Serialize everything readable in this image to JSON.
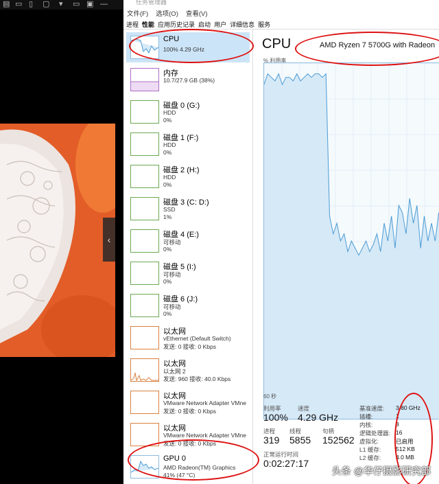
{
  "window_title": "任务管理器",
  "menu": [
    "文件(F)",
    "选项(O)",
    "查看(V)"
  ],
  "tabs": [
    "进程",
    "性能",
    "应用历史记录",
    "启动",
    "用户",
    "详细信息",
    "服务"
  ],
  "active_tab": "性能",
  "sidebar": [
    {
      "name": "CPU",
      "sub1": "100% 4.29 GHz",
      "sub2": "",
      "kind": "cpu"
    },
    {
      "name": "内存",
      "sub1": "10.7/27.9 GB (38%)",
      "sub2": "",
      "kind": "mem"
    },
    {
      "name": "磁盘 0 (G:)",
      "sub1": "HDD",
      "sub2": "0%",
      "kind": "disk"
    },
    {
      "name": "磁盘 1 (F:)",
      "sub1": "HDD",
      "sub2": "0%",
      "kind": "disk"
    },
    {
      "name": "磁盘 2 (H:)",
      "sub1": "HDD",
      "sub2": "0%",
      "kind": "disk"
    },
    {
      "name": "磁盘 3 (C: D:)",
      "sub1": "SSD",
      "sub2": "1%",
      "kind": "disk"
    },
    {
      "name": "磁盘 4 (E:)",
      "sub1": "可移动",
      "sub2": "0%",
      "kind": "disk"
    },
    {
      "name": "磁盘 5 (I:)",
      "sub1": "可移动",
      "sub2": "0%",
      "kind": "disk"
    },
    {
      "name": "磁盘 6 (J:)",
      "sub1": "可移动",
      "sub2": "0%",
      "kind": "disk"
    },
    {
      "name": "以太网",
      "sub1": "vEthernet (Default Switch)",
      "sub2": "发送: 0 接收: 0 Kbps",
      "kind": "net"
    },
    {
      "name": "以太网",
      "sub1": "以太网 2",
      "sub2": "发送: 960 接收: 40.0 Kbps",
      "kind": "net"
    },
    {
      "name": "以太网",
      "sub1": "VMware Network Adapter VMne",
      "sub2": "发送: 0 接收: 0 Kbps",
      "kind": "net"
    },
    {
      "name": "以太网",
      "sub1": "VMware Network Adapter VMne",
      "sub2": "发送: 0 接收: 0 Kbps",
      "kind": "net"
    },
    {
      "name": "GPU 0",
      "sub1": "AMD Radeon(TM) Graphics",
      "sub2": "41% (47 °C)",
      "kind": "gpu"
    }
  ],
  "main": {
    "title": "CPU",
    "model": "AMD Ryzen 7 5700G with Radeon",
    "util_label": "% 利用率",
    "time_label": "60 秒",
    "utilization_label": "利用率",
    "utilization": "100%",
    "speed_label": "速度",
    "speed": "4.29 GHz",
    "processes_label": "进程",
    "processes": "319",
    "threads_label": "线程",
    "threads": "5855",
    "handles_label": "句柄",
    "handles": "152562",
    "uptime_label": "正常运行时间",
    "uptime": "0:02:27:17",
    "details": [
      {
        "k": "基准速度:",
        "v": "3.80 GHz"
      },
      {
        "k": "插槽:",
        "v": "1"
      },
      {
        "k": "内核:",
        "v": "8"
      },
      {
        "k": "逻辑处理器:",
        "v": "16"
      },
      {
        "k": "虚拟化:",
        "v": "已启用"
      },
      {
        "k": "L1 缓存:",
        "v": "512 KB"
      },
      {
        "k": "L2 缓存:",
        "v": "4.0 MB"
      }
    ]
  },
  "cpu_history_percent": [
    94,
    97,
    96,
    95,
    97,
    94,
    96,
    96,
    95,
    97,
    95,
    96,
    97,
    96,
    97,
    97,
    96,
    97,
    57,
    52,
    55,
    50,
    52,
    47,
    50,
    48,
    46,
    48,
    50,
    47,
    49,
    52,
    47,
    55,
    50,
    57,
    48,
    60,
    58,
    52,
    62,
    55,
    60,
    48,
    57,
    50,
    55,
    50,
    58,
    53
  ],
  "watermark": "头条 @华仔摄影研究部",
  "colors": {
    "cpu_line": "#4a9bd4",
    "cpu_fill": "#d6e9f7",
    "annotation": "#dd1111",
    "selected_bg": "#cce4f7"
  }
}
